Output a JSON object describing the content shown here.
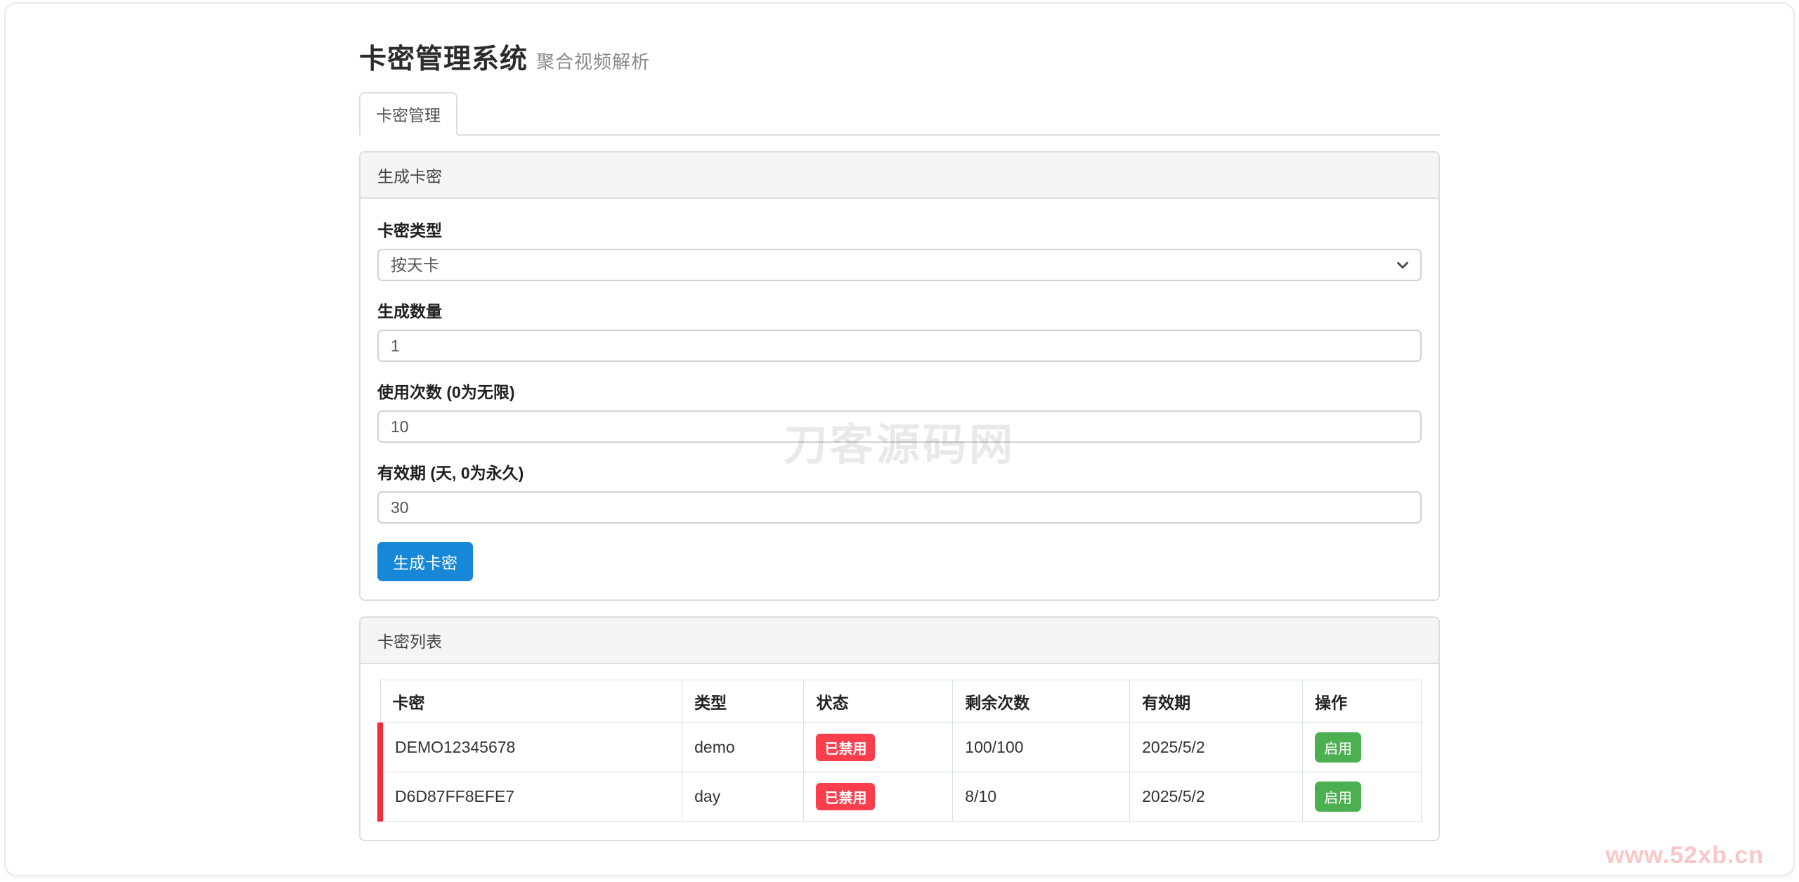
{
  "page": {
    "title": "卡密管理系统",
    "subtitle": "聚合视频解析"
  },
  "tabs": [
    {
      "label": "卡密管理",
      "active": true
    }
  ],
  "generate_panel": {
    "header": "生成卡密",
    "fields": [
      {
        "label": "卡密类型",
        "type": "select",
        "value": "按天卡"
      },
      {
        "label": "生成数量",
        "type": "input",
        "value": "1"
      },
      {
        "label": "使用次数 (0为无限)",
        "type": "input",
        "value": "10"
      },
      {
        "label": "有效期 (天, 0为永久)",
        "type": "input",
        "value": "30"
      }
    ],
    "submit_label": "生成卡密"
  },
  "list_panel": {
    "header": "卡密列表",
    "table": {
      "columns": [
        "卡密",
        "类型",
        "状态",
        "剩余次数",
        "有效期",
        "操作"
      ],
      "rows": [
        {
          "key": "DEMO12345678",
          "type": "demo",
          "status": "已禁用",
          "remaining": "100/100",
          "expiry": "2025/5/2",
          "action": "启用"
        },
        {
          "key": "D6D87FF8EFE7",
          "type": "day",
          "status": "已禁用",
          "remaining": "8/10",
          "expiry": "2025/5/2",
          "action": "启用"
        }
      ]
    }
  },
  "watermarks": {
    "center": "刀客源码网",
    "corner": "www.52xb.cn"
  },
  "colors": {
    "primary_button": "#1787d8",
    "danger_badge": "#fb3e4c",
    "success_button": "#4cb050",
    "row_stripe": "#f52a3a",
    "panel_header_bg": "#f5f5f5",
    "border": "#dddddd"
  }
}
